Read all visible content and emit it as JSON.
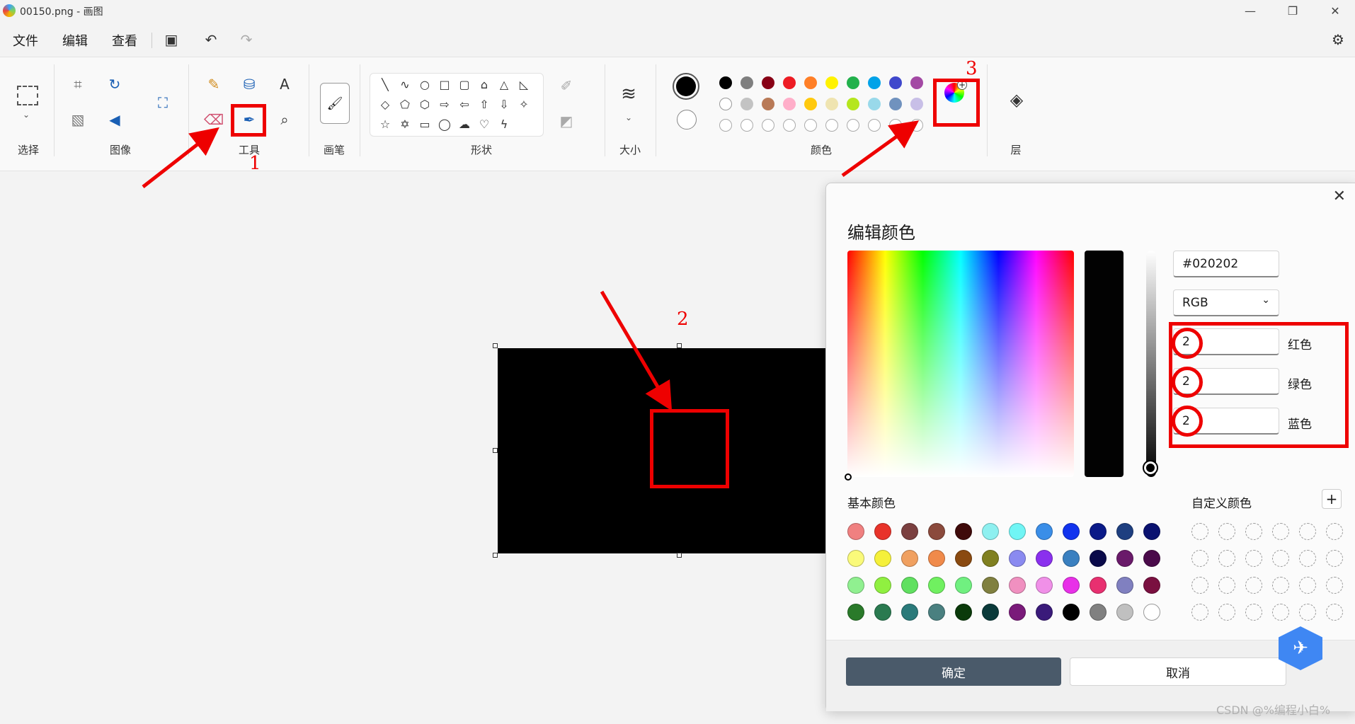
{
  "window": {
    "title": "00150.png - 画图"
  },
  "menu": {
    "file": "文件",
    "edit": "编辑",
    "view": "查看"
  },
  "ribbon": {
    "groups": {
      "select": "选择",
      "image": "图像",
      "tools": "工具",
      "brushes": "画笔",
      "shapes": "形状",
      "size": "大小",
      "colors": "颜色",
      "layers": "层"
    },
    "color_row1": [
      "#000000",
      "#7f7f7f",
      "#880015",
      "#ed1c24",
      "#ff7f27",
      "#fff200",
      "#22b14c",
      "#00a2e8",
      "#3f48cc",
      "#a349a4"
    ],
    "color_row2": [
      "#ffffff",
      "#c3c3c3",
      "#b97a57",
      "#ffaec9",
      "#ffc90e",
      "#efe4b0",
      "#b5e61d",
      "#99d9ea",
      "#7092be",
      "#c8bfe7"
    ],
    "color1": "#000000",
    "color2": "#ffffff"
  },
  "annotations": {
    "a1": "1",
    "a2": "2",
    "a3": "3"
  },
  "dialog": {
    "title": "编辑颜色",
    "hex_value": "#020202",
    "mode": "RGB",
    "red_value": "2",
    "green_value": "2",
    "blue_value": "2",
    "red_label": "红色",
    "green_label": "绿色",
    "blue_label": "蓝色",
    "basic_colors_label": "基本颜色",
    "custom_colors_label": "自定义颜色",
    "ok": "确定",
    "cancel": "取消",
    "basic_colors": [
      [
        "#f08080",
        "#e8332a",
        "#7b4040",
        "#8b4a3c",
        "#3f0a0a",
        "#8ef0f0",
        "#70f5f5",
        "#3a8ee8",
        "#1133ee",
        "#0a1a88",
        "#1e3f80",
        "#0a1270"
      ],
      [
        "#fafa7a",
        "#f5f03a",
        "#f0a060",
        "#f08a4a",
        "#8a4a10",
        "#808020",
        "#8a8af0",
        "#8a30ee",
        "#3a80c0",
        "#0a0a4a",
        "#6a1a6a",
        "#4a0a4a"
      ],
      [
        "#90f090",
        "#90f040",
        "#60e060",
        "#70f060",
        "#70f080",
        "#808040",
        "#f090c0",
        "#f090e8",
        "#e830e8",
        "#e83070",
        "#8080c0",
        "#7a1040"
      ],
      [
        "#2a7a2a",
        "#2a7a50",
        "#2a7a7a",
        "#4a8080",
        "#0a3a0a",
        "#0a3a3a",
        "#7a1a7a",
        "#3a1a7a",
        "#000000",
        "#808080",
        "#c0c0c0",
        "#ffffff"
      ]
    ]
  },
  "watermark": "CSDN @%编程小白%"
}
